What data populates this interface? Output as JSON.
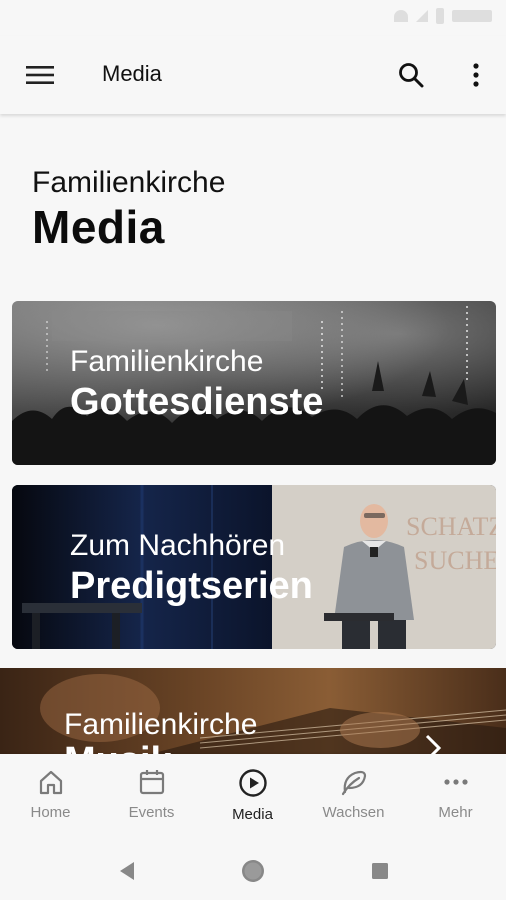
{
  "app_bar": {
    "title": "Media",
    "menu_icon": "hamburger-menu-icon",
    "search_icon": "search-icon",
    "more_icon": "more-vertical-icon"
  },
  "hero": {
    "subtitle": "Familienkirche",
    "title": "Media"
  },
  "cards": [
    {
      "subtitle": "Familienkirche",
      "title": "Gottesdienste"
    },
    {
      "subtitle": "Zum Nachhören",
      "title": "Predigtserien",
      "screen_text_1": "SCHATZ",
      "screen_text_2": "SUCHE"
    },
    {
      "subtitle": "Familienkirche",
      "title": "Musik",
      "chevron_icon": "chevron-right-icon"
    }
  ],
  "bottom_nav": {
    "items": [
      {
        "label": "Home",
        "icon": "home-icon"
      },
      {
        "label": "Events",
        "icon": "calendar-icon"
      },
      {
        "label": "Media",
        "icon": "play-circle-icon",
        "active": true
      },
      {
        "label": "Wachsen",
        "icon": "leaf-icon"
      },
      {
        "label": "Mehr",
        "icon": "more-horizontal-icon"
      }
    ]
  },
  "colors": {
    "background": "#f7f7f7",
    "text": "#111111",
    "nav_inactive": "#8a8a8a",
    "nav_active": "#222222"
  }
}
